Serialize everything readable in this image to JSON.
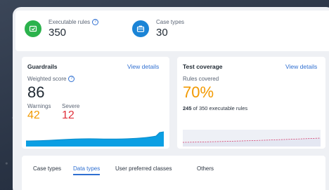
{
  "kpis": {
    "executable_rules": {
      "label": "Executable rules",
      "value": "350",
      "icon": "rules-icon",
      "color": "#2bb24c"
    },
    "case_types": {
      "label": "Case types",
      "value": "30",
      "icon": "briefcase-icon",
      "color": "#1b84d6"
    }
  },
  "guardrails": {
    "title": "Guardrails",
    "link": "View details",
    "weighted_label": "Weighted score",
    "weighted_value": "86",
    "warnings_label": "Warnings",
    "warnings_value": "42",
    "severe_label": "Severe",
    "severe_value": "12",
    "chart_color": "#0b9fe3"
  },
  "coverage": {
    "title": "Test coverage",
    "link": "View details",
    "rules_label": "Rules covered",
    "rules_value": "70%",
    "covered_count": "245",
    "covered_suffix": "of 350 executable rules",
    "chart_color": "#d63a6a"
  },
  "tabs": [
    {
      "label": "Case types",
      "active": false
    },
    {
      "label": "Data types",
      "active": true
    },
    {
      "label": "User preferred classes",
      "active": false
    },
    {
      "label": "Others",
      "active": false
    }
  ]
}
